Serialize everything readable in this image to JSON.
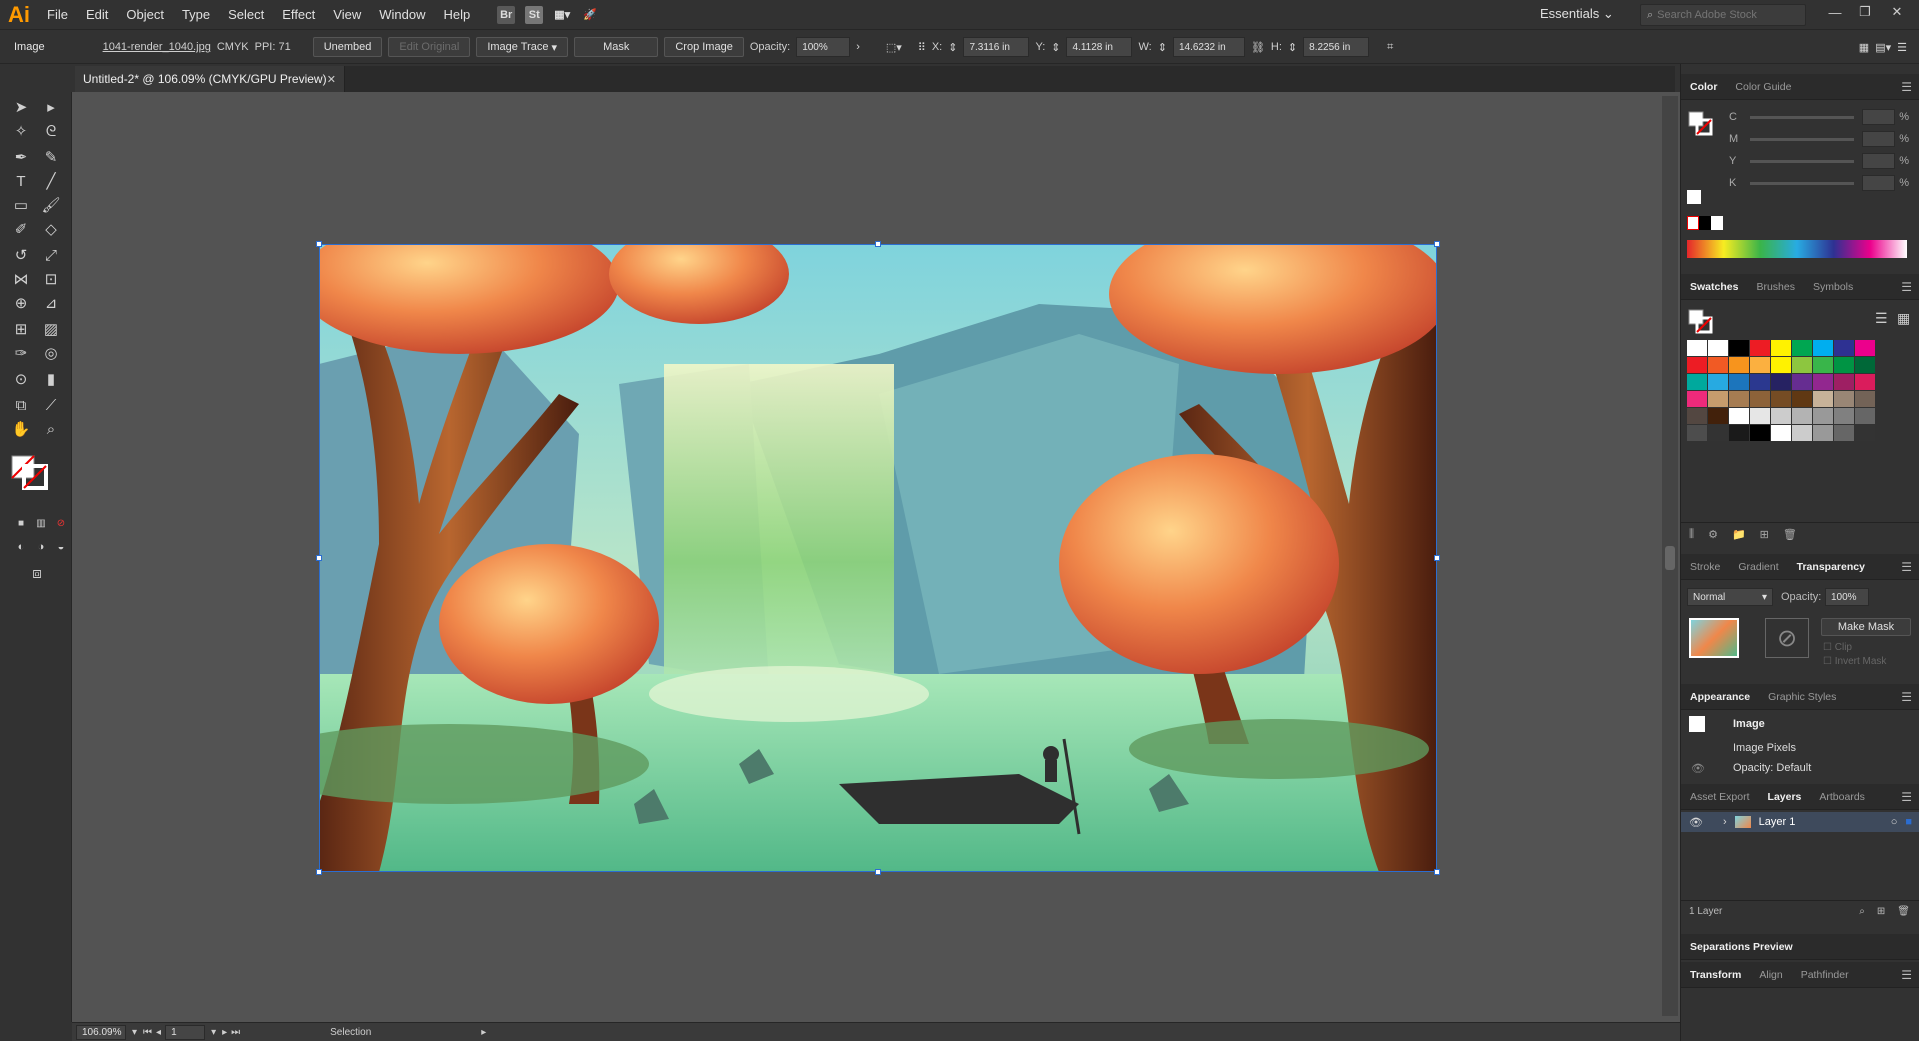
{
  "app": {
    "logo": "Ai"
  },
  "menu": [
    "File",
    "Edit",
    "Object",
    "Type",
    "Select",
    "Effect",
    "View",
    "Window",
    "Help"
  ],
  "menubar_icons": {
    "br": "Br",
    "st": "St"
  },
  "workspace": "Essentials",
  "search": {
    "placeholder": "Search Adobe Stock"
  },
  "control": {
    "type": "Image",
    "filename": "1041-render_1040.jpg",
    "colormode": "CMYK",
    "ppi": "PPI: 71",
    "embed": "Unembed",
    "edit_original": "Edit Original",
    "image_trace": "Image Trace",
    "mask": "Mask",
    "crop": "Crop Image",
    "opacity_label": "Opacity:",
    "opacity": "100%",
    "x_label": "X:",
    "x": "7.3116 in",
    "y_label": "Y:",
    "y": "4.1128 in",
    "w_label": "W:",
    "w": "14.6232 in",
    "h_label": "H:",
    "h": "8.2256 in"
  },
  "document": {
    "tab": "Untitled-2* @ 106.09% (CMYK/GPU Preview)"
  },
  "status": {
    "zoom": "106.09%",
    "page": "1",
    "tool": "Selection"
  },
  "panels": {
    "color": {
      "tabs": [
        "Color",
        "Color Guide"
      ],
      "channels": [
        "C",
        "M",
        "Y",
        "K"
      ],
      "unit": "%"
    },
    "swatches": {
      "tabs": [
        "Swatches",
        "Brushes",
        "Symbols"
      ]
    },
    "transparency": {
      "tabs": [
        "Stroke",
        "Gradient",
        "Transparency"
      ],
      "blend": "Normal",
      "opacity_label": "Opacity:",
      "opacity": "100%",
      "make_mask": "Make Mask",
      "clip": "Clip",
      "invert": "Invert Mask"
    },
    "appearance": {
      "tabs": [
        "Appearance",
        "Graphic Styles"
      ],
      "title": "Image",
      "row1": "Image Pixels",
      "row2": "Opacity:",
      "row2_val": "Default"
    },
    "layers": {
      "tabs": [
        "Asset Export",
        "Layers",
        "Artboards"
      ],
      "layer": "Layer 1",
      "count": "1 Layer"
    },
    "separations": "Separations Preview",
    "transform": {
      "tabs": [
        "Transform",
        "Align",
        "Pathfinder"
      ]
    }
  },
  "swatch_colors": [
    [
      "#ffffff",
      "#ffffff",
      "#000000",
      "#ed1c24",
      "#fff200",
      "#00a651",
      "#00aeef",
      "#2e3192",
      "#ec008c"
    ],
    [
      "#ed1c24",
      "#f15a24",
      "#f7941d",
      "#fbb040",
      "#fff200",
      "#8dc63f",
      "#39b54a",
      "#009444",
      "#006838"
    ],
    [
      "#00a99d",
      "#27aae1",
      "#1c75bc",
      "#2b388f",
      "#262262",
      "#662d91",
      "#92278f",
      "#9e1f63",
      "#da1c5c"
    ],
    [
      "#ee2a7b",
      "#c69c6d",
      "#a67c52",
      "#8c6239",
      "#754c24",
      "#603813",
      "#c7b299",
      "#998675",
      "#736357"
    ],
    [
      "#534741",
      "#42210b",
      "#ffffff",
      "#e6e6e6",
      "#cccccc",
      "#b3b3b3",
      "#999999",
      "#808080",
      "#666666"
    ],
    [
      "#4d4d4d",
      "#333333",
      "#1a1a1a",
      "#000000",
      "#ffffff",
      "#cccccc",
      "#999999",
      "#666666",
      "#333333"
    ]
  ]
}
